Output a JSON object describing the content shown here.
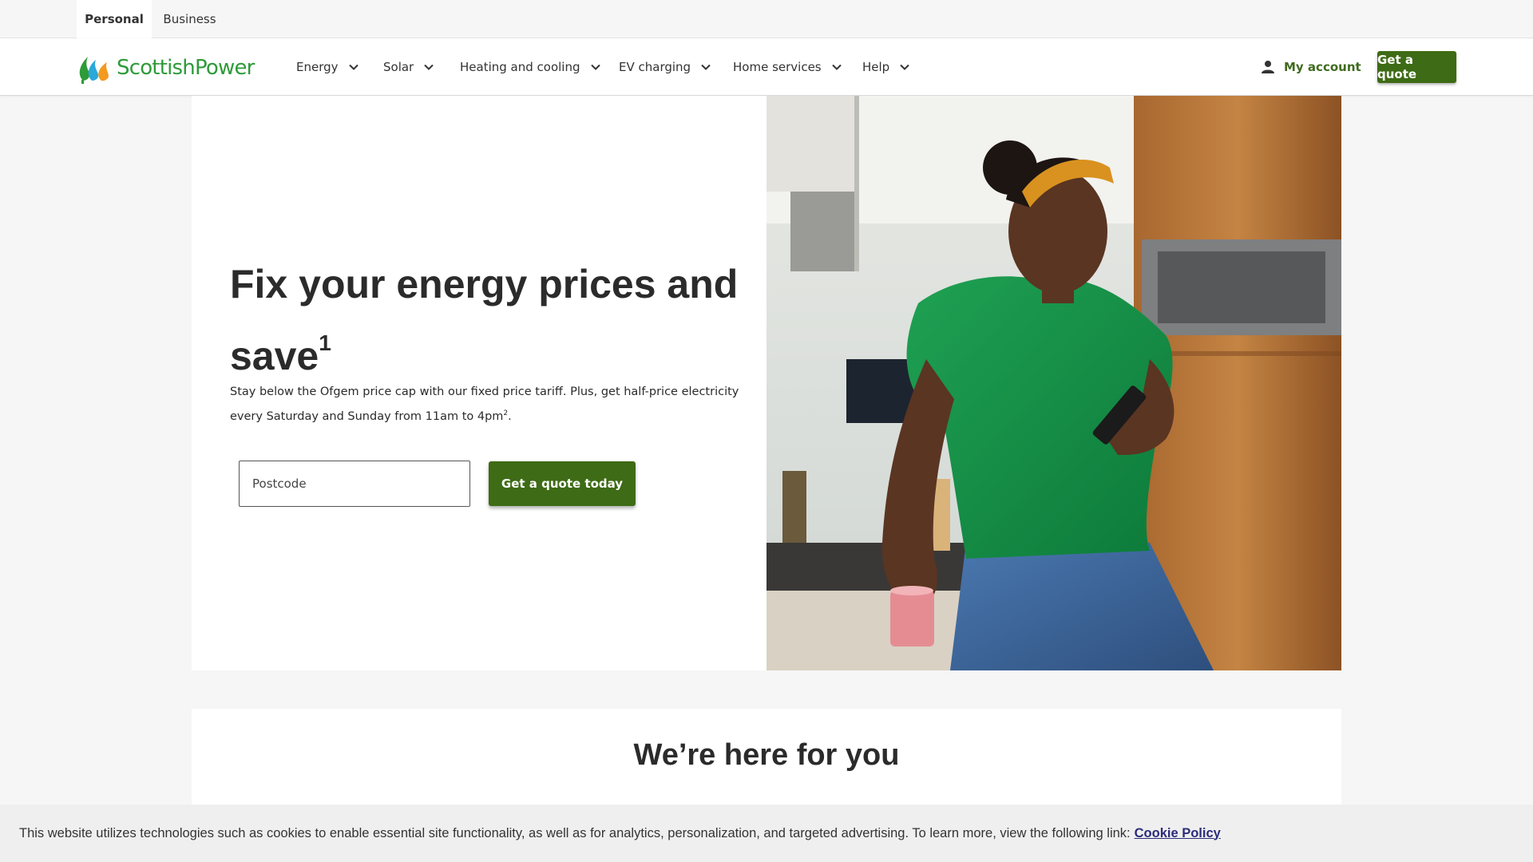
{
  "audience_tabs": [
    {
      "label": "Personal",
      "active": true
    },
    {
      "label": "Business",
      "active": false
    }
  ],
  "brand": {
    "name": "ScottishPower",
    "primary_green": "#3e6b15",
    "logo_green": "#2e9b39",
    "logo_orange": "#f39a1f",
    "logo_blue": "#2aa8dc"
  },
  "nav": {
    "items": [
      {
        "label": "Energy",
        "icon": "chevron-down-icon"
      },
      {
        "label": "Solar",
        "icon": "chevron-down-icon"
      },
      {
        "label": "Heating and cooling",
        "icon": "chevron-down-icon"
      },
      {
        "label": "EV charging",
        "icon": "chevron-down-icon"
      },
      {
        "label": "Home services",
        "icon": "chevron-down-icon"
      },
      {
        "label": "Help",
        "icon": "chevron-down-icon"
      }
    ],
    "account_label": "My account",
    "account_icon": "person-icon",
    "quote_label": "Get a quote"
  },
  "hero": {
    "title": "Fix your energy prices and save",
    "title_footnote": "1",
    "body": "Stay below the Ofgem price cap with our fixed price tariff. Plus, get half-price electricity every Saturday and Sunday from 11am to 4pm",
    "body_footnote": "2",
    "body_end": ".",
    "postcode_placeholder": "Postcode",
    "cta_label": "Get a quote today",
    "image_subject": "woman in green top smiling at phone holding pink mug in kitchen"
  },
  "section": {
    "title": "We’re here for you"
  },
  "cookie": {
    "text": "This website utilizes technologies such as cookies to enable essential site functionality, as well as for analytics, personalization, and targeted advertising. To learn more, view the following link:",
    "link_label": "Cookie Policy"
  }
}
